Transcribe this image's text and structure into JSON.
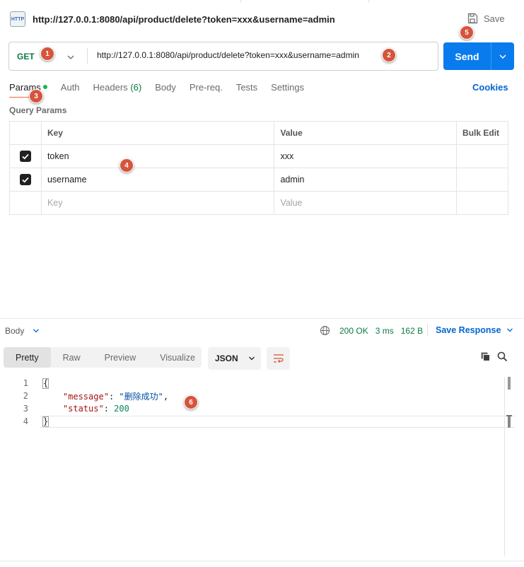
{
  "title": {
    "badge": "HTTP",
    "url": "http://127.0.0.1:8080/api/product/delete?token=xxx&username=admin",
    "save_label": "Save"
  },
  "request": {
    "method": "GET",
    "url": "http://127.0.0.1:8080/api/product/delete?token=xxx&username=admin",
    "send_label": "Send"
  },
  "tabs": {
    "params": "Params",
    "auth": "Auth",
    "headers": "Headers",
    "headers_count": "(6)",
    "body": "Body",
    "prereq": "Pre-req.",
    "tests": "Tests",
    "settings": "Settings",
    "cookies": "Cookies"
  },
  "query_params": {
    "label": "Query Params",
    "headers": {
      "key": "Key",
      "value": "Value",
      "bulk": "Bulk Edit"
    },
    "rows": [
      {
        "key": "token",
        "value": "xxx",
        "checked": true
      },
      {
        "key": "username",
        "value": "admin",
        "checked": true
      }
    ],
    "placeholder": {
      "key": "Key",
      "value": "Value"
    }
  },
  "response": {
    "body_label": "Body",
    "status": "200 OK",
    "time": "3 ms",
    "size": "162 B",
    "save_response": "Save Response",
    "formats": {
      "pretty": "Pretty",
      "raw": "Raw",
      "preview": "Preview",
      "visualize": "Visualize"
    },
    "language": "JSON",
    "lines": {
      "n1": "1",
      "n2": "2",
      "n3": "3",
      "n4": "4",
      "open": "{",
      "msg_key": "\"message\"",
      "msg_val": "\"删除成功\"",
      "status_key": "\"status\"",
      "status_val": "200",
      "close": "}"
    }
  },
  "markers": {
    "m1": "1",
    "m2": "2",
    "m3": "3",
    "m4": "4",
    "m5": "5",
    "m6": "6"
  },
  "colors": {
    "accent": "#097bed",
    "method_get": "#0c7a43",
    "marker": "#d6543a",
    "link": "#0265d2"
  }
}
